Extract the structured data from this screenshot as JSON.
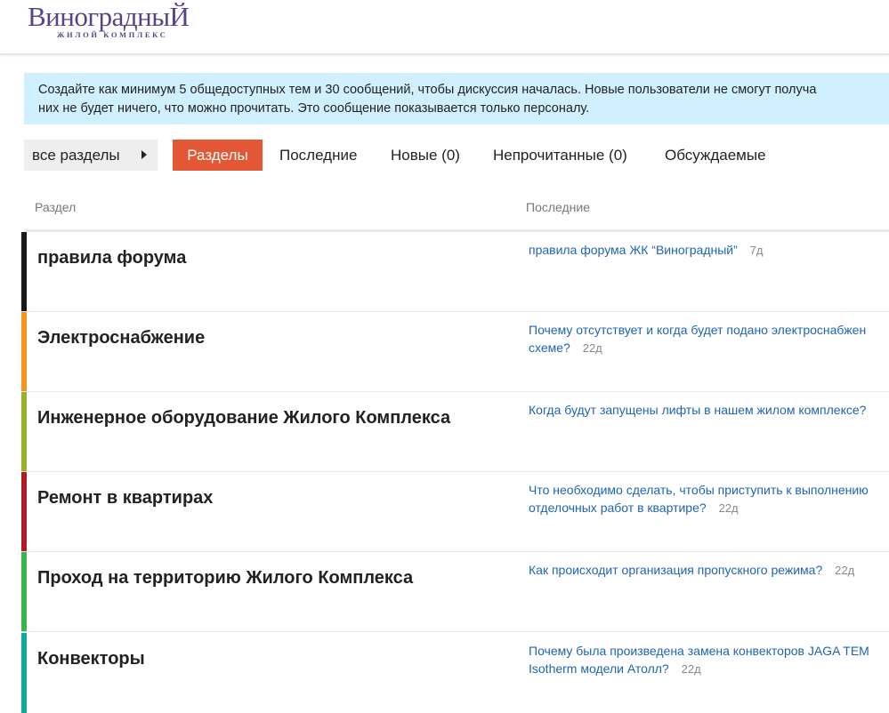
{
  "header": {
    "logo_name": "ВиноградныЙ",
    "logo_subtitle": "ЖИЛОЙ КОМПЛЕКС"
  },
  "notice": {
    "line1": "Создайте как минимум 5 общедоступных тем и 30 сообщений, чтобы дискуссия началась. Новые пользователи не смогут получа",
    "line2": "них не будет ничего, что можно прочитать. Это сообщение показывается только персоналу."
  },
  "nav": {
    "category_dropdown": "все разделы",
    "items": [
      "Разделы",
      "Последние",
      "Новые (0)",
      "Непрочитанные (0)",
      "Обсуждаемые"
    ]
  },
  "table": {
    "col_category": "Раздел",
    "col_latest": "Последние"
  },
  "categories": [
    {
      "name": "правила форума",
      "color": "#1a1a1a",
      "topic": "правила форума ЖК “Виноградный”",
      "topic_l2": "",
      "age": "7д"
    },
    {
      "name": "Электроснабжение",
      "color": "#f7941d",
      "topic": "Почему отсутствует и когда будет подано электроснабжен",
      "topic_l2": "схеме?",
      "age": "22д"
    },
    {
      "name": "Инженерное оборудование Жилого Комплекса",
      "color": "#92b32a",
      "topic": "Когда будут запущены лифты в нашем жилом комплексе?",
      "topic_l2": "",
      "age": ""
    },
    {
      "name": "Ремонт в квартирах",
      "color": "#b21a26",
      "topic": "Что необходимо сделать, чтобы приступить к выполнению",
      "topic_l2": "отделочных работ в квартире?",
      "age": "22д"
    },
    {
      "name": "Проход на территорию Жилого Комплекса",
      "color": "#3ab54a",
      "topic": "Как происходит организация пропускного режима?",
      "topic_l2": "",
      "age": "22д"
    },
    {
      "name": "Конвекторы",
      "color": "#12a89d",
      "topic": "Почему была произведена замена конвекторов JAGA TEM",
      "topic_l2": "Isotherm модели Атолл?",
      "age": "22д"
    }
  ]
}
